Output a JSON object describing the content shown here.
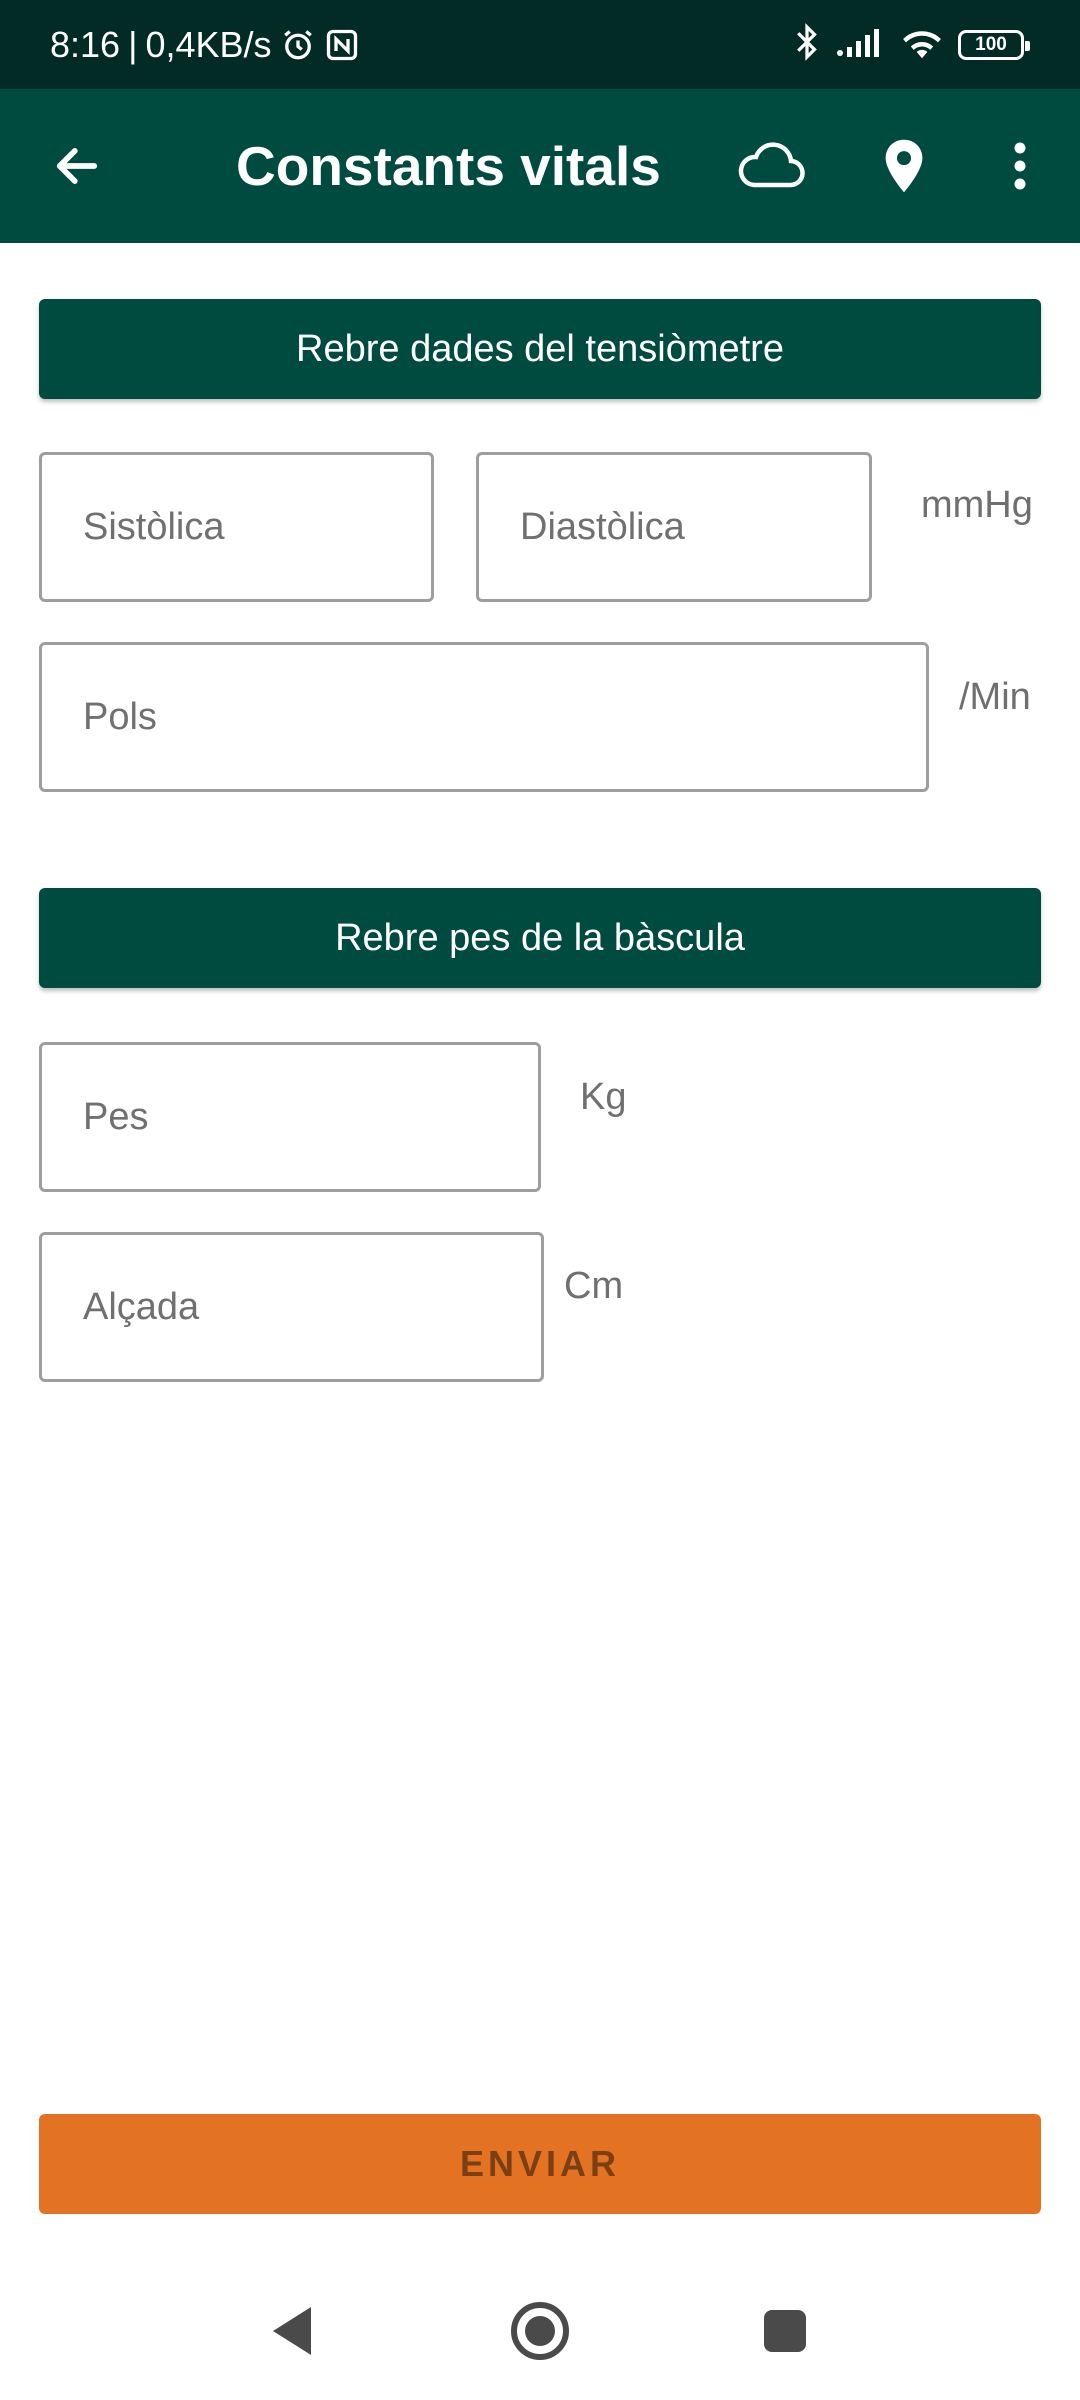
{
  "status_bar": {
    "time": "8:16",
    "separator": "|",
    "network_speed": "0,4KB/s",
    "battery_level": "100",
    "icons": [
      "alarm-icon",
      "nfc-icon",
      "bluetooth-icon",
      "signal-icon",
      "wifi-icon",
      "battery-icon"
    ]
  },
  "app_bar": {
    "title": "Constants vitals",
    "icons": [
      "back-arrow-icon",
      "cloud-icon",
      "location-pin-icon",
      "more-vert-icon"
    ]
  },
  "blood_pressure": {
    "button_label": "Rebre dades del tensiòmetre",
    "systolic_placeholder": "Sistòlica",
    "diastolic_placeholder": "Diastòlica",
    "pressure_unit": "mmHg",
    "pulse_placeholder": "Pols",
    "pulse_unit": "/Min"
  },
  "scale": {
    "button_label": "Rebre pes de la bàscula",
    "weight_placeholder": "Pes",
    "weight_unit": "Kg",
    "height_placeholder": "Alçada",
    "height_unit": "Cm"
  },
  "submit": {
    "label": "ENVIAR"
  },
  "colors": {
    "status_bar": "#032b25",
    "primary": "#004b40",
    "accent": "#e37222",
    "border": "#9e9e9e"
  }
}
